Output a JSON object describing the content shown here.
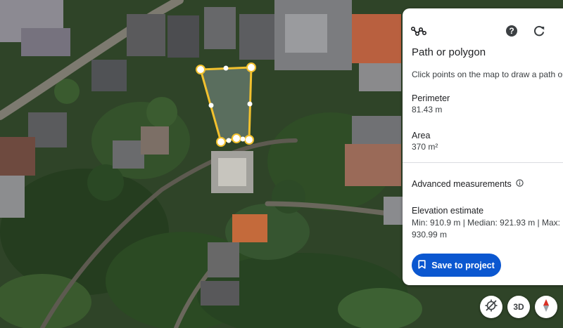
{
  "panel": {
    "title": "Path or polygon",
    "description": "Click points on the map to draw a path or",
    "perimeter_label": "Perimeter",
    "perimeter_value": "81.43 m",
    "area_label": "Area",
    "area_value": "370 m²",
    "advanced_label": "Advanced measurements",
    "elevation_label": "Elevation estimate",
    "elevation_values": "Min: 910.9 m | Median: 921.93 m | Max: 930.99 m",
    "save_button": "Save to project"
  },
  "map_controls": {
    "threed_label": "3D"
  },
  "colors": {
    "polygon_outline": "#f2c12e",
    "accent_button": "#0b57d0",
    "compass_red": "#d93025"
  },
  "icons": [
    "path-tool-icon",
    "help-icon",
    "reset-icon",
    "info-icon",
    "bookmark-icon",
    "recenter-icon",
    "compass-icon"
  ]
}
